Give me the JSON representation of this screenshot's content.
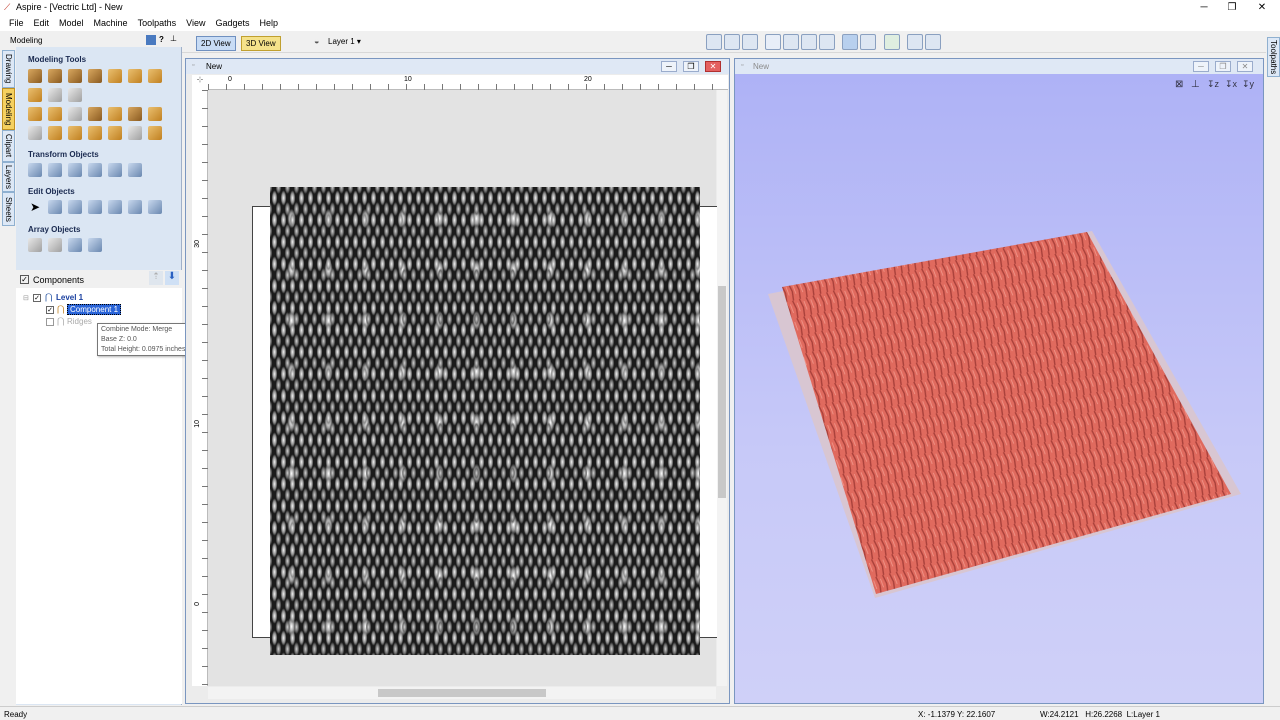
{
  "window": {
    "title": "Aspire - [Vectric Ltd] - New",
    "minimize": "─",
    "maximize": "❐",
    "close": "✕"
  },
  "menu": [
    "File",
    "Edit",
    "Model",
    "Machine",
    "Toolpaths",
    "View",
    "Gadgets",
    "Help"
  ],
  "toolbar": {
    "tab_2d": "2D View",
    "tab_3d": "3D View",
    "layer": "Layer 1 ▾"
  },
  "left_tabs": [
    "Drawing",
    "Modeling",
    "Clipart",
    "Layers",
    "Sheets"
  ],
  "right_tabs": [
    "Toolpaths"
  ],
  "panel": {
    "title": "Modeling",
    "pin": "?",
    "sections": {
      "modeling_tools": "Modeling Tools",
      "transform_objects": "Transform Objects",
      "edit_objects": "Edit Objects",
      "array_objects": "Array Objects"
    }
  },
  "components": {
    "title": "Components",
    "level": "Level 1",
    "items": [
      {
        "label": "Component 1",
        "selected": true,
        "checked": true
      },
      {
        "label": "Ridges",
        "selected": false,
        "checked": false
      }
    ],
    "tooltip": [
      "Combine Mode: Merge",
      "Base Z: 0.0",
      "Total Height: 0.0975 inches"
    ]
  },
  "view2d": {
    "title": "New",
    "ruler_top": [
      "0",
      "10",
      "20"
    ],
    "ruler_left": [
      "30",
      "10",
      "0"
    ]
  },
  "view3d": {
    "title": "New"
  },
  "status": {
    "left": "Ready",
    "coords": "X: -1.1379 Y: 22.1607",
    "dims": "W:24.2121   H:26.2268  L:Layer 1"
  }
}
